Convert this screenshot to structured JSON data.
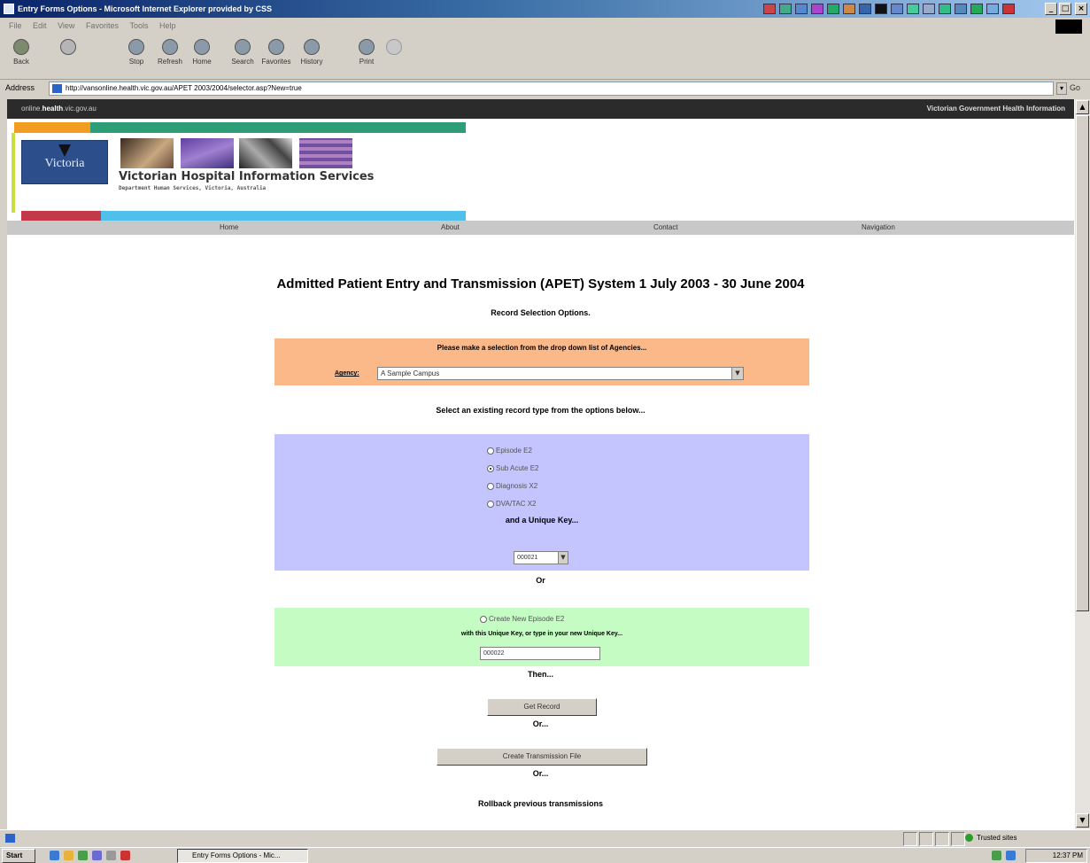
{
  "window": {
    "title": "Entry Forms Options - Microsoft Internet Explorer provided by CSS",
    "min": "_",
    "max": "□",
    "close": "×"
  },
  "menu": [
    "File",
    "Edit",
    "View",
    "Favorites",
    "Tools",
    "Help"
  ],
  "toolbar": [
    {
      "label": "Back",
      "icon": "back-icon"
    },
    {
      "label": "",
      "icon": "forward-icon"
    },
    {
      "label": "Stop",
      "icon": "stop-icon"
    },
    {
      "label": "Refresh",
      "icon": "refresh-icon"
    },
    {
      "label": "Home",
      "icon": "home-icon"
    },
    {
      "label": "Search",
      "icon": "search-icon"
    },
    {
      "label": "Favorites",
      "icon": "favorites-icon"
    },
    {
      "label": "History",
      "icon": "history-icon"
    },
    {
      "label": "Print",
      "icon": "print-icon"
    }
  ],
  "address": {
    "label": "Address",
    "url": "http://vansonline.health.vic.gov.au/APET 2003/2004/selector.asp?New=true",
    "go": "Go"
  },
  "site": {
    "domain_prefix": "online.",
    "domain_bold": "health",
    "domain_suffix": ".vic.gov.au",
    "gov_info": "Victorian Government Health Information",
    "logo_text": "Victoria",
    "title": "Victorian Hospital Information Services",
    "subtitle": "Department Human Services, Victoria, Australia"
  },
  "nav": [
    "Home",
    "About",
    "Contact",
    "Navigation"
  ],
  "page": {
    "title": "Admitted Patient Entry and Transmission (APET) System 1 July 2003 - 30 June 2004",
    "record_selection": "Record Selection Options."
  },
  "agency": {
    "prompt": "Please make a selection from the drop down list of Agencies...",
    "label": "Agency:",
    "selected": "A Sample Campus"
  },
  "record_type": {
    "prompt": "Select an existing record type from the options below...",
    "options": [
      {
        "label": "Episode E2",
        "checked": false
      },
      {
        "label": "Sub Acute E2",
        "checked": true
      },
      {
        "label": "Diagnosis X2",
        "checked": false
      },
      {
        "label": "DVA/TAC X2",
        "checked": false
      }
    ],
    "unique_key_label": "and a Unique Key...",
    "key_value": "000021",
    "or": "Or"
  },
  "new_episode": {
    "option": "Create New Episode E2",
    "prompt": "with this Unique Key, or type in your new Unique Key...",
    "value": "000022",
    "then": "Then..."
  },
  "actions": {
    "get_record": "Get Record",
    "or1": "Or...",
    "create_transmission": "Create Transmission File",
    "or2": "Or...",
    "rollback": "Rollback previous transmissions"
  },
  "status": {
    "zone": "Trusted sites"
  },
  "taskbar": {
    "start": "Start",
    "task": "Entry Forms Options - Mic...",
    "clock": "12:37 PM"
  },
  "colors": {
    "agency_panel": "#fbb98a",
    "type_panel": "#c4c4ff",
    "new_panel": "#c4fcc4",
    "stripe_orange": "#f29d22",
    "stripe_green": "#2e9e76",
    "stripe_red": "#c23a4a",
    "stripe_blue": "#4ec0ea",
    "stripe_lime": "#c6e040"
  }
}
